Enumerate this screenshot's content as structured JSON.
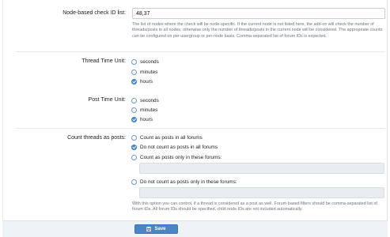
{
  "node_check": {
    "label": "Node-based check ID list:",
    "value": "48,37",
    "help": "The list of nodes where the check will be node-specific. If the current node is not listed here, the add-on will check the number of threads/posts in all nodes, otherwise only the number of threads/posts in the current node will be considered. The appropriate counts can be configured on per-usergroup or per-node basis. Comma-separated list of forum IDs is expected."
  },
  "thread_time": {
    "label": "Thread Time Unit:",
    "options": [
      "seconds",
      "minutes",
      "hours"
    ],
    "selected": "hours"
  },
  "post_time": {
    "label": "Post Time Unit:",
    "options": [
      "seconds",
      "minutes",
      "hours"
    ],
    "selected": "hours"
  },
  "count_threads": {
    "label": "Count threads as posts:",
    "options": [
      "Count as posts in all forums",
      "Do not count as posts in all forums",
      "Count as posts only in these forums:",
      "Do not count as posts only in these forums:"
    ],
    "selected": "Do not count as posts in all forums",
    "help": "With this option you can control, if a thread is considered as a post as well. Forum-based filters should be comma-separated list of forum IDs. All forum IDs should be specified, child node IDs are not included automatically."
  },
  "footer": {
    "save_label": "Save"
  },
  "colors": {
    "accent": "#4a85c5",
    "help_text": "#6c7480",
    "footer_bg": "#f0f3f6"
  }
}
